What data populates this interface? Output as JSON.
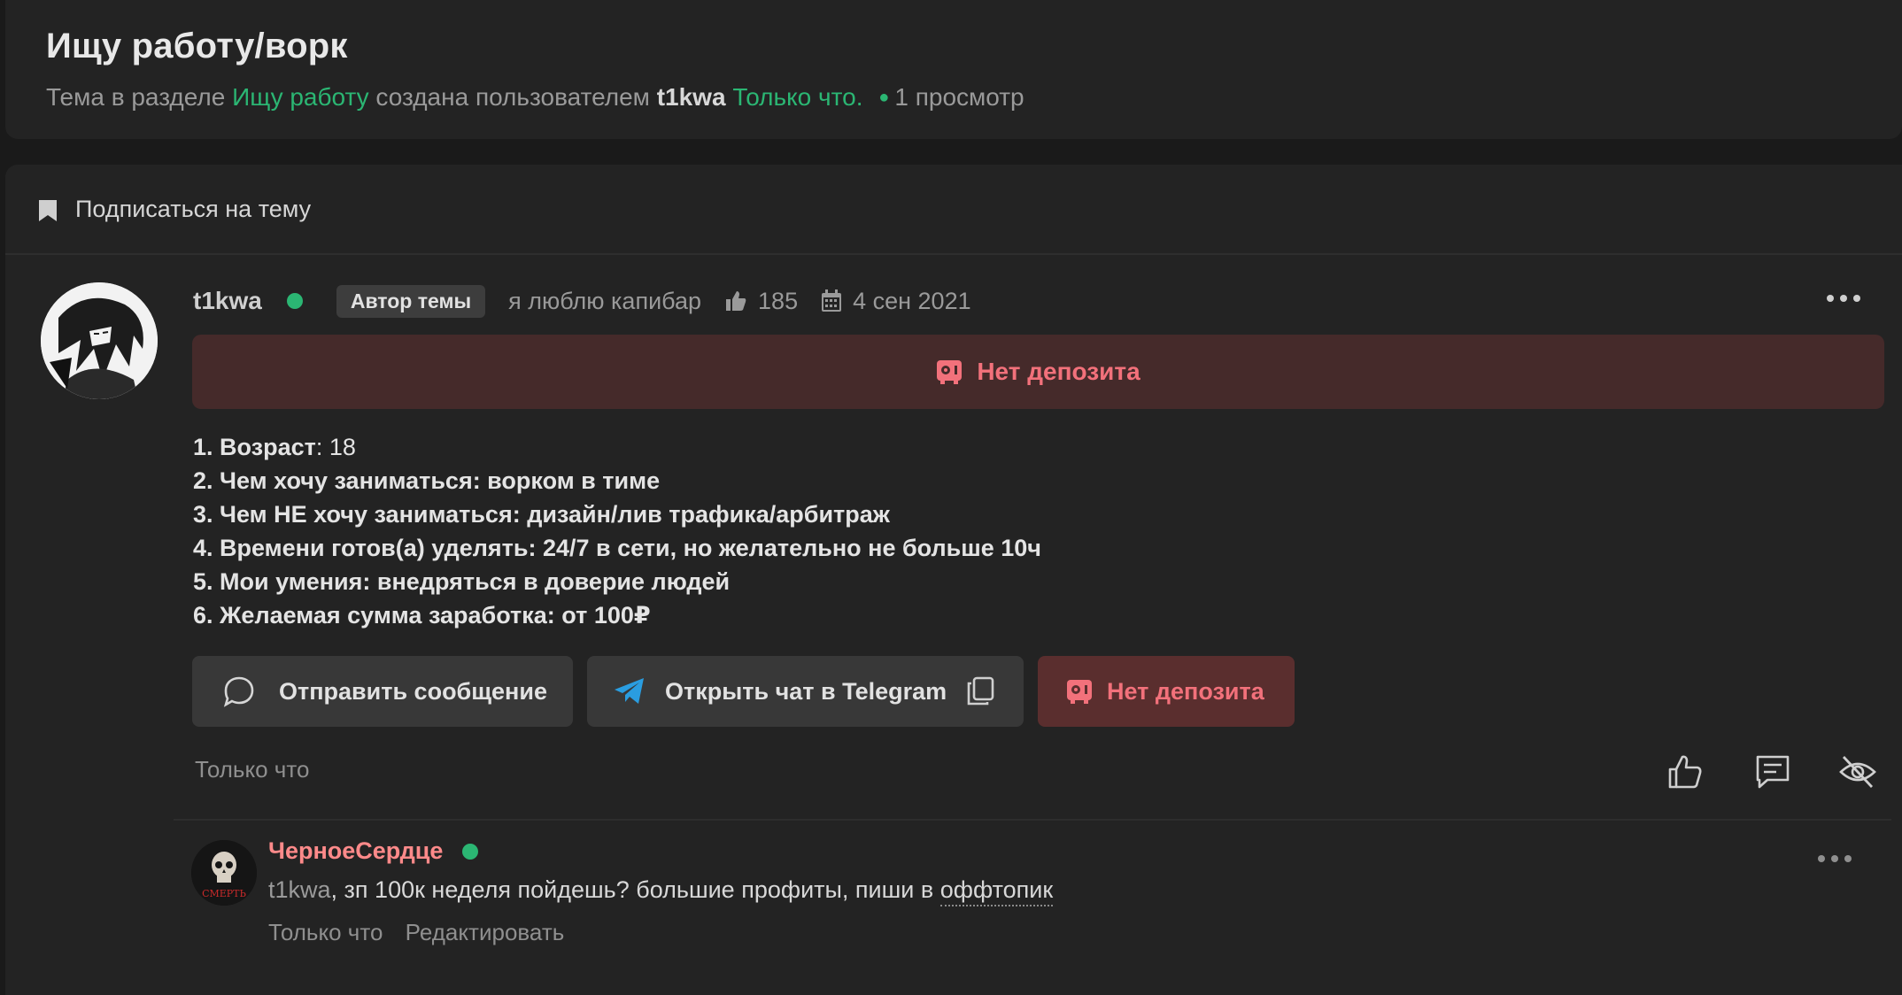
{
  "thread": {
    "title": "Ищу работу/ворк",
    "meta_prefix": "Тема в разделе",
    "section": "Ищу работу",
    "meta_middle": "создана пользователем",
    "author": "t1kwa",
    "time": "Только что.",
    "views": "1 просмотр"
  },
  "subscribe": {
    "label": "Подписаться на тему"
  },
  "post": {
    "author": "t1kwa",
    "badge": "Автор темы",
    "status": "я люблю капибар",
    "likes": "185",
    "reg_date": "4 сен 2021",
    "deposit_banner": "Нет депозита",
    "lines": [
      {
        "label": "1. Возраст",
        "value": ": 18"
      },
      {
        "label": "2. Чем хочу заниматься: ворком в тиме",
        "value": ""
      },
      {
        "label": "3. Чем НЕ хочу заниматься: дизайн/лив трафика/арбитраж",
        "value": ""
      },
      {
        "label": "4. Времени готов(а) уделять: 24/7 в сети, но желательно не больше 10ч",
        "value": ""
      },
      {
        "label": "5. Мои умения: внедряться в доверие людей",
        "value": ""
      },
      {
        "label": "6. Желаемая сумма заработка: от 100₽",
        "value": ""
      }
    ],
    "buttons": {
      "message": "Отправить сообщение",
      "telegram": "Открыть чат в Telegram",
      "deposit": "Нет депозита"
    },
    "time": "Только что"
  },
  "comment": {
    "author": "ЧерноеСердце",
    "mention": "t1kwa",
    "text": ", зп 100к неделя пойдешь? большие профиты, пиши в ",
    "link": "оффтопик",
    "time": "Только что",
    "edit": "Редактировать",
    "avatar_text": "СМЕРТЬ"
  },
  "colors": {
    "accent_green": "#2bb673",
    "deposit_red": "#f2717b",
    "comment_author": "#ff8a8a"
  }
}
